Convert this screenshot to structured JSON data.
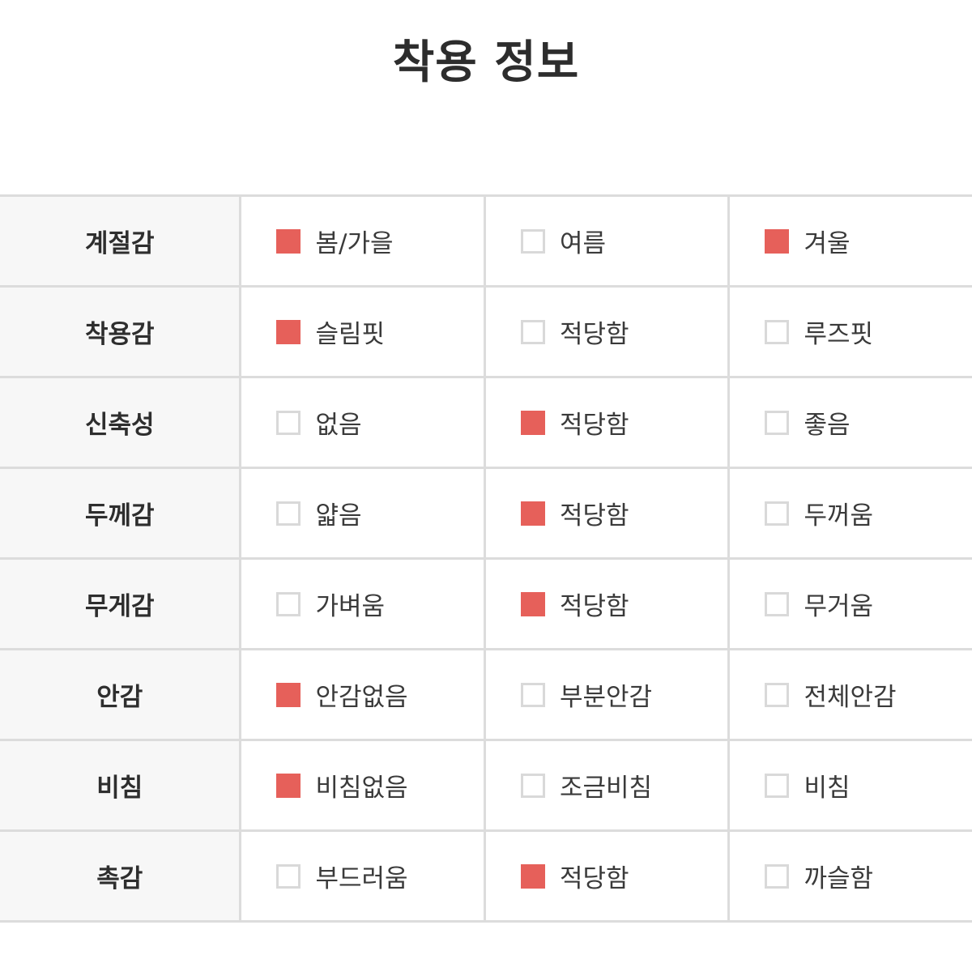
{
  "title": "착용 정보",
  "accent_color": "#e6605a",
  "rows": [
    {
      "label": "계절감",
      "options": [
        {
          "label": "봄/가을",
          "checked": true
        },
        {
          "label": "여름",
          "checked": false
        },
        {
          "label": "겨울",
          "checked": true
        }
      ]
    },
    {
      "label": "착용감",
      "options": [
        {
          "label": "슬림핏",
          "checked": true
        },
        {
          "label": "적당함",
          "checked": false
        },
        {
          "label": "루즈핏",
          "checked": false
        }
      ]
    },
    {
      "label": "신축성",
      "options": [
        {
          "label": "없음",
          "checked": false
        },
        {
          "label": "적당함",
          "checked": true
        },
        {
          "label": "좋음",
          "checked": false
        }
      ]
    },
    {
      "label": "두께감",
      "options": [
        {
          "label": "얇음",
          "checked": false
        },
        {
          "label": "적당함",
          "checked": true
        },
        {
          "label": "두꺼움",
          "checked": false
        }
      ]
    },
    {
      "label": "무게감",
      "options": [
        {
          "label": "가벼움",
          "checked": false
        },
        {
          "label": "적당함",
          "checked": true
        },
        {
          "label": "무거움",
          "checked": false
        }
      ]
    },
    {
      "label": "안감",
      "options": [
        {
          "label": "안감없음",
          "checked": true
        },
        {
          "label": "부분안감",
          "checked": false
        },
        {
          "label": "전체안감",
          "checked": false
        }
      ]
    },
    {
      "label": "비침",
      "options": [
        {
          "label": "비침없음",
          "checked": true
        },
        {
          "label": "조금비침",
          "checked": false
        },
        {
          "label": "비침",
          "checked": false
        }
      ]
    },
    {
      "label": "촉감",
      "options": [
        {
          "label": "부드러움",
          "checked": false
        },
        {
          "label": "적당함",
          "checked": true
        },
        {
          "label": "까슬함",
          "checked": false
        }
      ]
    }
  ]
}
